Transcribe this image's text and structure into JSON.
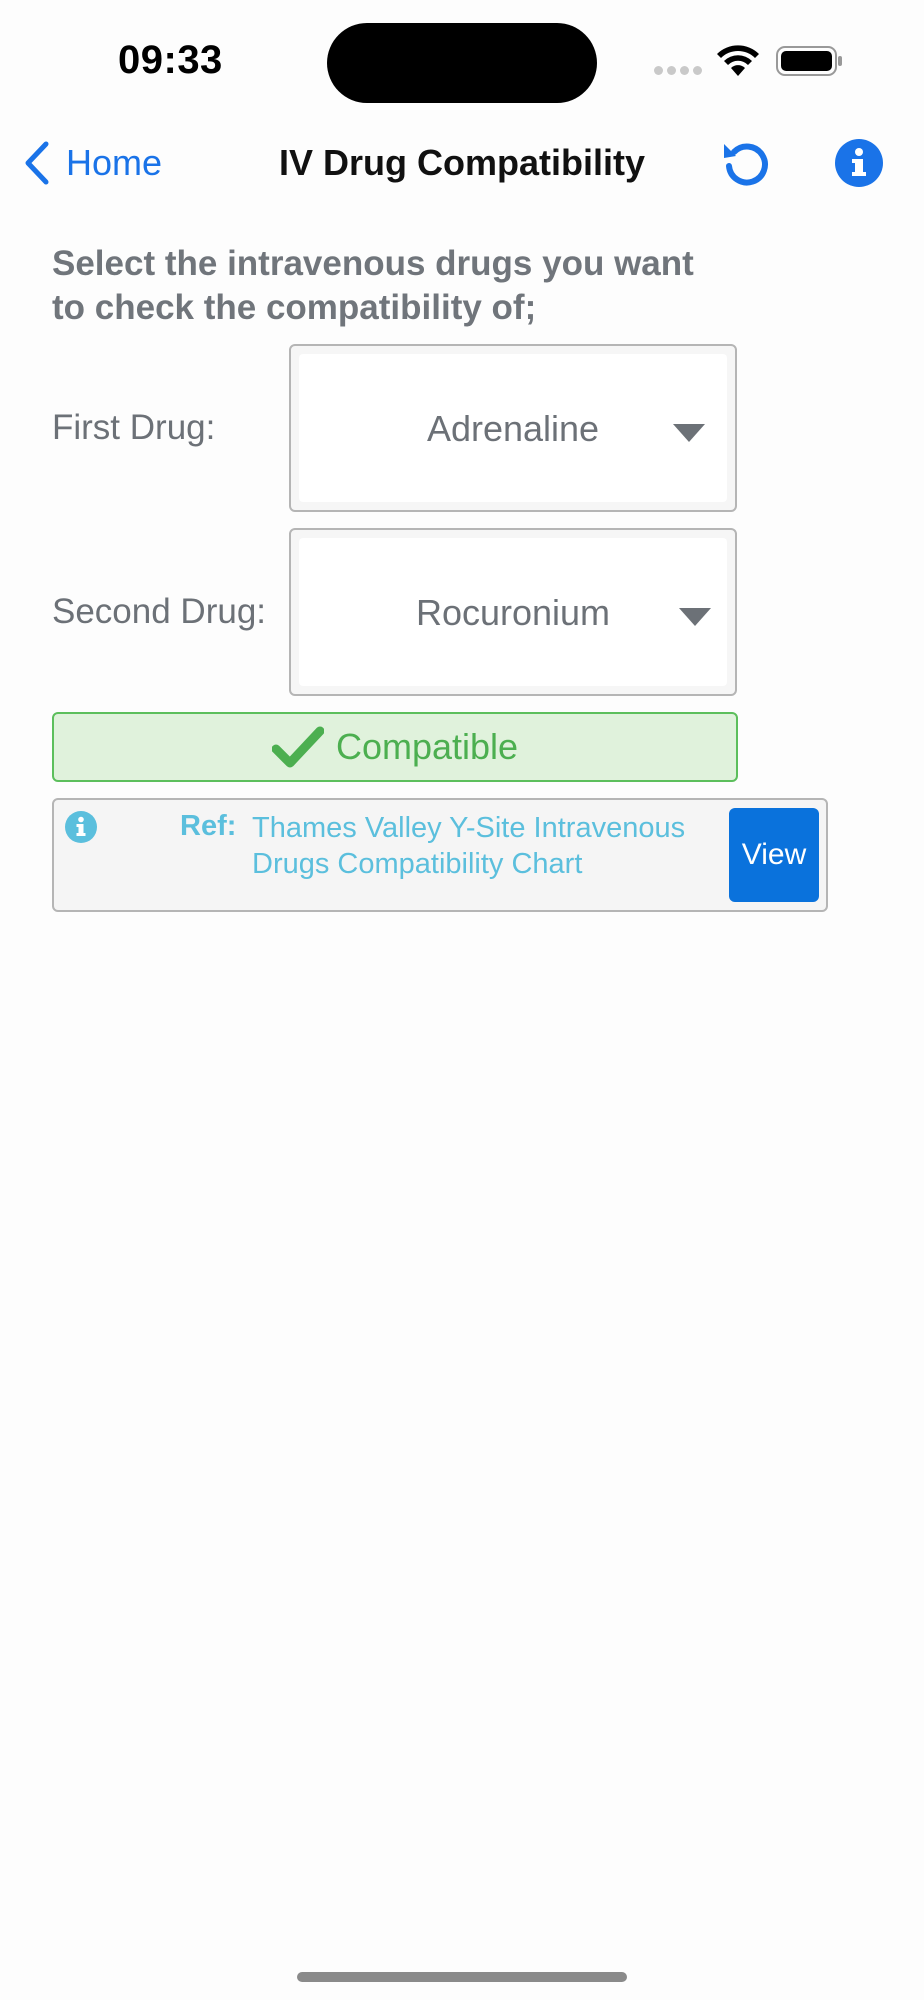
{
  "status_bar": {
    "time": "09:33"
  },
  "nav": {
    "back_label": "Home",
    "title": "IV Drug Compatibility",
    "refresh_icon": "refresh-icon",
    "info_icon": "info-icon"
  },
  "content": {
    "instructions": "Select the intravenous drugs you want to check the compatibility of;",
    "first_drug": {
      "label": "First Drug:",
      "value": "Adrenaline"
    },
    "second_drug": {
      "label": "Second Drug:",
      "value": "Rocuronium"
    },
    "result": {
      "text": "Compatible",
      "icon": "check-icon"
    },
    "reference": {
      "label": "Ref:",
      "text": "Thames Valley Y-Site Intravenous Drugs Compatibility Chart",
      "button_label": "View"
    }
  },
  "colors": {
    "accent": "#1a73e8",
    "compatible_text": "#4caf50",
    "compatible_bg": "#e0f2dc",
    "reference_text": "#5bbfdd",
    "view_button": "#0a72dc"
  }
}
